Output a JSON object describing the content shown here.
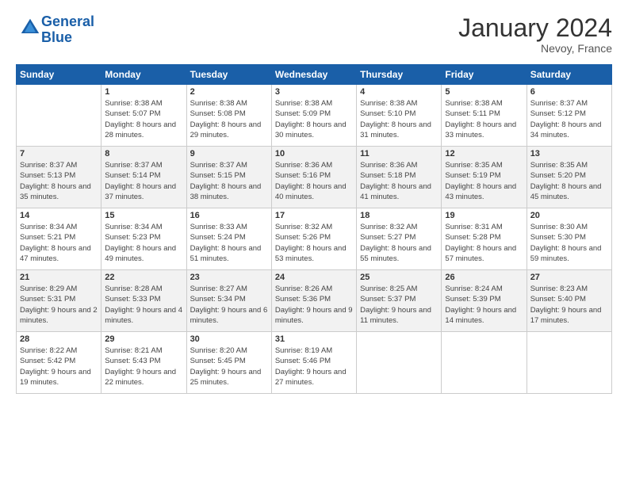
{
  "header": {
    "logo_line1": "General",
    "logo_line2": "Blue",
    "month_title": "January 2024",
    "location": "Nevoy, France"
  },
  "weekdays": [
    "Sunday",
    "Monday",
    "Tuesday",
    "Wednesday",
    "Thursday",
    "Friday",
    "Saturday"
  ],
  "weeks": [
    [
      {
        "day": "",
        "sunrise": "",
        "sunset": "",
        "daylight": ""
      },
      {
        "day": "1",
        "sunrise": "Sunrise: 8:38 AM",
        "sunset": "Sunset: 5:07 PM",
        "daylight": "Daylight: 8 hours and 28 minutes."
      },
      {
        "day": "2",
        "sunrise": "Sunrise: 8:38 AM",
        "sunset": "Sunset: 5:08 PM",
        "daylight": "Daylight: 8 hours and 29 minutes."
      },
      {
        "day": "3",
        "sunrise": "Sunrise: 8:38 AM",
        "sunset": "Sunset: 5:09 PM",
        "daylight": "Daylight: 8 hours and 30 minutes."
      },
      {
        "day": "4",
        "sunrise": "Sunrise: 8:38 AM",
        "sunset": "Sunset: 5:10 PM",
        "daylight": "Daylight: 8 hours and 31 minutes."
      },
      {
        "day": "5",
        "sunrise": "Sunrise: 8:38 AM",
        "sunset": "Sunset: 5:11 PM",
        "daylight": "Daylight: 8 hours and 33 minutes."
      },
      {
        "day": "6",
        "sunrise": "Sunrise: 8:37 AM",
        "sunset": "Sunset: 5:12 PM",
        "daylight": "Daylight: 8 hours and 34 minutes."
      }
    ],
    [
      {
        "day": "7",
        "sunrise": "Sunrise: 8:37 AM",
        "sunset": "Sunset: 5:13 PM",
        "daylight": "Daylight: 8 hours and 35 minutes."
      },
      {
        "day": "8",
        "sunrise": "Sunrise: 8:37 AM",
        "sunset": "Sunset: 5:14 PM",
        "daylight": "Daylight: 8 hours and 37 minutes."
      },
      {
        "day": "9",
        "sunrise": "Sunrise: 8:37 AM",
        "sunset": "Sunset: 5:15 PM",
        "daylight": "Daylight: 8 hours and 38 minutes."
      },
      {
        "day": "10",
        "sunrise": "Sunrise: 8:36 AM",
        "sunset": "Sunset: 5:16 PM",
        "daylight": "Daylight: 8 hours and 40 minutes."
      },
      {
        "day": "11",
        "sunrise": "Sunrise: 8:36 AM",
        "sunset": "Sunset: 5:18 PM",
        "daylight": "Daylight: 8 hours and 41 minutes."
      },
      {
        "day": "12",
        "sunrise": "Sunrise: 8:35 AM",
        "sunset": "Sunset: 5:19 PM",
        "daylight": "Daylight: 8 hours and 43 minutes."
      },
      {
        "day": "13",
        "sunrise": "Sunrise: 8:35 AM",
        "sunset": "Sunset: 5:20 PM",
        "daylight": "Daylight: 8 hours and 45 minutes."
      }
    ],
    [
      {
        "day": "14",
        "sunrise": "Sunrise: 8:34 AM",
        "sunset": "Sunset: 5:21 PM",
        "daylight": "Daylight: 8 hours and 47 minutes."
      },
      {
        "day": "15",
        "sunrise": "Sunrise: 8:34 AM",
        "sunset": "Sunset: 5:23 PM",
        "daylight": "Daylight: 8 hours and 49 minutes."
      },
      {
        "day": "16",
        "sunrise": "Sunrise: 8:33 AM",
        "sunset": "Sunset: 5:24 PM",
        "daylight": "Daylight: 8 hours and 51 minutes."
      },
      {
        "day": "17",
        "sunrise": "Sunrise: 8:32 AM",
        "sunset": "Sunset: 5:26 PM",
        "daylight": "Daylight: 8 hours and 53 minutes."
      },
      {
        "day": "18",
        "sunrise": "Sunrise: 8:32 AM",
        "sunset": "Sunset: 5:27 PM",
        "daylight": "Daylight: 8 hours and 55 minutes."
      },
      {
        "day": "19",
        "sunrise": "Sunrise: 8:31 AM",
        "sunset": "Sunset: 5:28 PM",
        "daylight": "Daylight: 8 hours and 57 minutes."
      },
      {
        "day": "20",
        "sunrise": "Sunrise: 8:30 AM",
        "sunset": "Sunset: 5:30 PM",
        "daylight": "Daylight: 8 hours and 59 minutes."
      }
    ],
    [
      {
        "day": "21",
        "sunrise": "Sunrise: 8:29 AM",
        "sunset": "Sunset: 5:31 PM",
        "daylight": "Daylight: 9 hours and 2 minutes."
      },
      {
        "day": "22",
        "sunrise": "Sunrise: 8:28 AM",
        "sunset": "Sunset: 5:33 PM",
        "daylight": "Daylight: 9 hours and 4 minutes."
      },
      {
        "day": "23",
        "sunrise": "Sunrise: 8:27 AM",
        "sunset": "Sunset: 5:34 PM",
        "daylight": "Daylight: 9 hours and 6 minutes."
      },
      {
        "day": "24",
        "sunrise": "Sunrise: 8:26 AM",
        "sunset": "Sunset: 5:36 PM",
        "daylight": "Daylight: 9 hours and 9 minutes."
      },
      {
        "day": "25",
        "sunrise": "Sunrise: 8:25 AM",
        "sunset": "Sunset: 5:37 PM",
        "daylight": "Daylight: 9 hours and 11 minutes."
      },
      {
        "day": "26",
        "sunrise": "Sunrise: 8:24 AM",
        "sunset": "Sunset: 5:39 PM",
        "daylight": "Daylight: 9 hours and 14 minutes."
      },
      {
        "day": "27",
        "sunrise": "Sunrise: 8:23 AM",
        "sunset": "Sunset: 5:40 PM",
        "daylight": "Daylight: 9 hours and 17 minutes."
      }
    ],
    [
      {
        "day": "28",
        "sunrise": "Sunrise: 8:22 AM",
        "sunset": "Sunset: 5:42 PM",
        "daylight": "Daylight: 9 hours and 19 minutes."
      },
      {
        "day": "29",
        "sunrise": "Sunrise: 8:21 AM",
        "sunset": "Sunset: 5:43 PM",
        "daylight": "Daylight: 9 hours and 22 minutes."
      },
      {
        "day": "30",
        "sunrise": "Sunrise: 8:20 AM",
        "sunset": "Sunset: 5:45 PM",
        "daylight": "Daylight: 9 hours and 25 minutes."
      },
      {
        "day": "31",
        "sunrise": "Sunrise: 8:19 AM",
        "sunset": "Sunset: 5:46 PM",
        "daylight": "Daylight: 9 hours and 27 minutes."
      },
      {
        "day": "",
        "sunrise": "",
        "sunset": "",
        "daylight": ""
      },
      {
        "day": "",
        "sunrise": "",
        "sunset": "",
        "daylight": ""
      },
      {
        "day": "",
        "sunrise": "",
        "sunset": "",
        "daylight": ""
      }
    ]
  ]
}
